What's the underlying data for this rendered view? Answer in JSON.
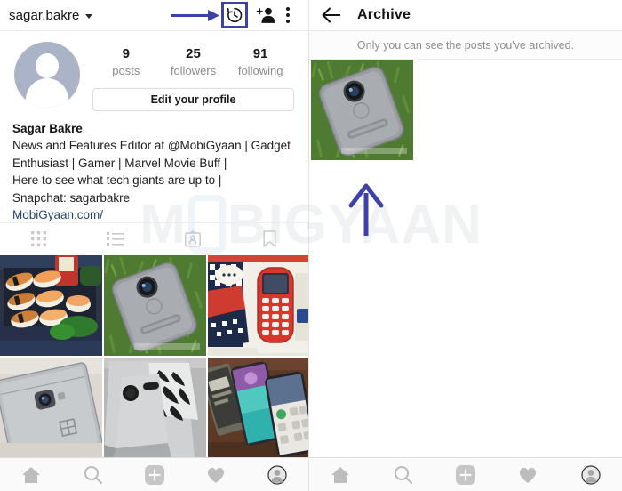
{
  "accent": {
    "annotation_blue": "#3d42a8",
    "link_blue": "#26456b",
    "muted_text": "#8e8e8e",
    "watermark": "MOBIGYAAN"
  },
  "left_panel": {
    "topbar": {
      "username": "sagar.bakre",
      "caret_icon": "chevron-down-icon",
      "archive_icon": "history-clock-icon",
      "add_user_icon": "add-person-icon",
      "more_icon": "more-vertical-icon",
      "annotation_arrow_icon": "right-arrow-annotation-icon",
      "highlight_box_label": "archive-highlight-box"
    },
    "profile": {
      "avatar_icon": "default-avatar-icon",
      "stats": [
        {
          "number": "9",
          "label": "posts"
        },
        {
          "number": "25",
          "label": "followers"
        },
        {
          "number": "91",
          "label": "following"
        }
      ],
      "edit_button": "Edit your profile",
      "bio_name": "Sagar Bakre",
      "bio_lines": [
        "News and Features Editor at @MobiGyaan | Gadget",
        "Enthusiast | Gamer | Marvel Movie Buff |",
        "Here to see what tech giants are up to |",
        "Snapchat: sagarbakre"
      ],
      "bio_link": "MobiGyaan.com/"
    },
    "tabs": [
      {
        "name": "tab-grid",
        "icon": "grid-icon"
      },
      {
        "name": "tab-list",
        "icon": "list-icon"
      },
      {
        "name": "tab-tagged",
        "icon": "tagged-person-icon"
      },
      {
        "name": "tab-saved",
        "icon": "bookmark-icon"
      }
    ],
    "grid_posts": [
      {
        "alt": "sushi-platter-photo"
      },
      {
        "alt": "moto-phone-on-grass-photo"
      },
      {
        "alt": "nokia-3310-box-photo"
      },
      {
        "alt": "oneplus-phone-back-photo"
      },
      {
        "alt": "sony-xperia-phone-photo"
      },
      {
        "alt": "three-phones-on-table-photo"
      }
    ]
  },
  "right_panel": {
    "topbar": {
      "back_icon": "back-arrow-icon",
      "title": "Archive"
    },
    "note": "Only you can see the posts you've archived.",
    "archived_posts": [
      {
        "alt": "moto-phone-on-grass-archived-photo"
      }
    ],
    "annotation_arrow_icon": "up-arrow-annotation-icon"
  },
  "bottom_nav": [
    {
      "name": "nav-home",
      "icon": "home-icon"
    },
    {
      "name": "nav-search",
      "icon": "search-icon"
    },
    {
      "name": "nav-add",
      "icon": "plus-square-icon"
    },
    {
      "name": "nav-activity",
      "icon": "heart-icon"
    },
    {
      "name": "nav-profile",
      "icon": "profile-avatar-icon"
    }
  ]
}
